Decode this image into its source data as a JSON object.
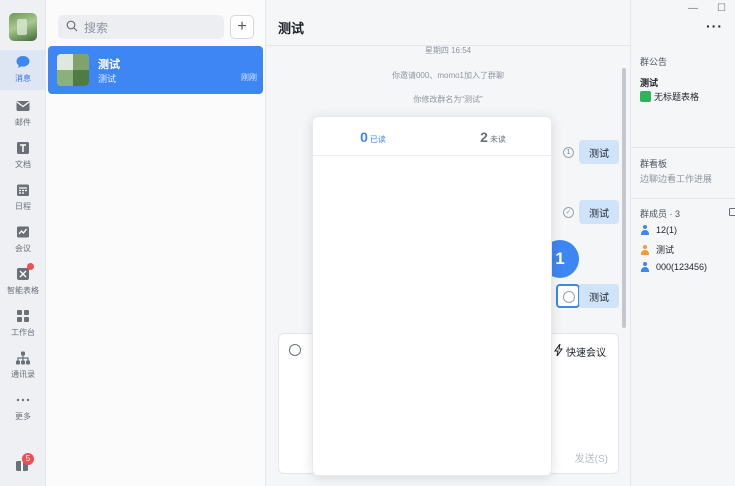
{
  "rail": {
    "items": [
      {
        "label": "消息",
        "icon": "chat-bubble-icon"
      },
      {
        "label": "邮件",
        "icon": "mail-icon"
      },
      {
        "label": "文档",
        "icon": "document-icon"
      },
      {
        "label": "日程",
        "icon": "calendar-icon"
      },
      {
        "label": "会议",
        "icon": "meeting-icon"
      },
      {
        "label": "智能表格",
        "icon": "smart-sheet-icon"
      },
      {
        "label": "工作台",
        "icon": "workbench-icon"
      },
      {
        "label": "通讯录",
        "icon": "contacts-icon"
      },
      {
        "label": "更多",
        "icon": "more-dots-icon"
      }
    ],
    "badge": "5"
  },
  "convlist": {
    "search_placeholder": "搜索",
    "add_label": "+",
    "item": {
      "name": "测试",
      "last": "测试",
      "time": "刚刚"
    }
  },
  "chat": {
    "title": "测试",
    "system_msgs": [
      "星期四 16:54",
      "你邀请000、momo1加入了群聊",
      "你修改群名为“测试”"
    ],
    "messages": [
      {
        "text": "测试",
        "status": "1"
      },
      {
        "text": "测试",
        "status": "✓"
      },
      {
        "text": "测试",
        "status": ""
      }
    ],
    "step_marker": "1",
    "quick_meeting": "快速会议",
    "send": "发送(S)"
  },
  "popover": {
    "read_count": "0",
    "read_label": "已读",
    "unread_count": "2",
    "unread_label": "未读"
  },
  "info": {
    "more": "···",
    "announce_title": "群公告",
    "announce_name": "测试",
    "announce_file": "无标题表格",
    "board_title": "群看板",
    "board_desc": "边聊边看工作进展",
    "members_title": "群成员 · 3",
    "members": [
      {
        "name": "12(1)",
        "color": "#3e86f4"
      },
      {
        "name": "测试",
        "color": "#f29a38"
      },
      {
        "name": "000(123456)",
        "color": "#3e86f4"
      }
    ]
  },
  "colors": {
    "accent": "#3e86f4",
    "bubble": "#cfe3fb",
    "badge": "#f04f4f"
  }
}
